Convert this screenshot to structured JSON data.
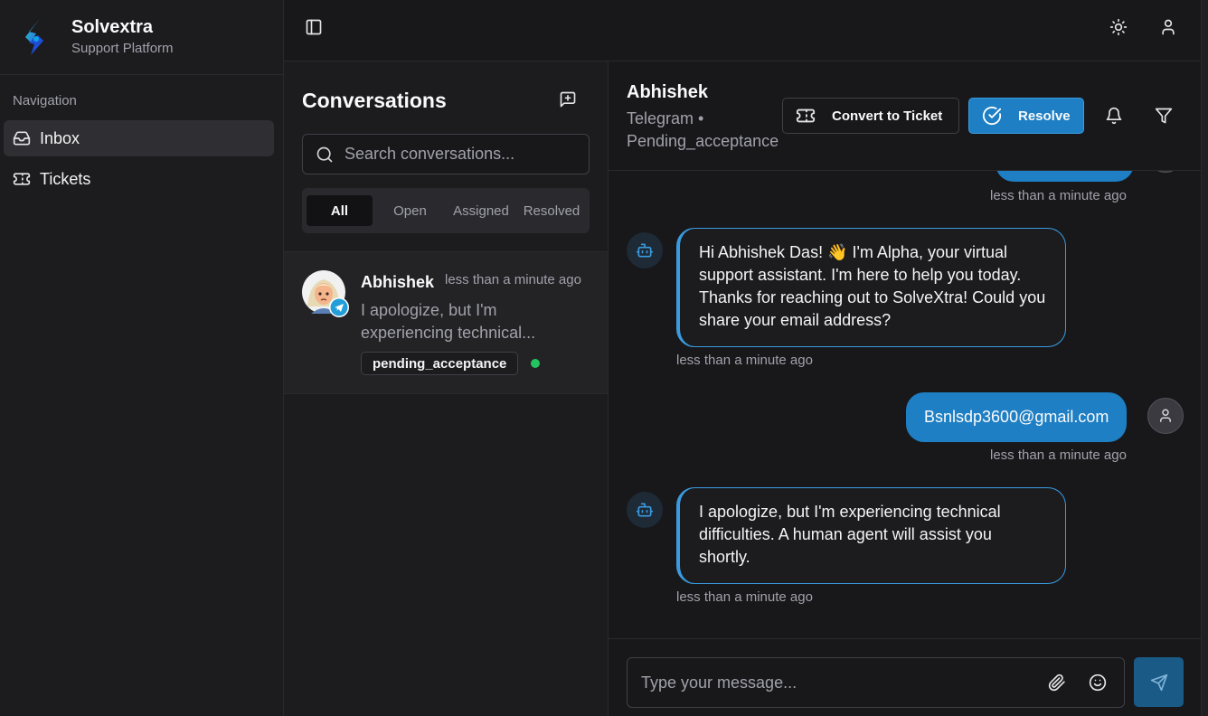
{
  "brand": {
    "name": "Solvextra",
    "subtitle": "Support Platform"
  },
  "nav": {
    "heading": "Navigation",
    "items": [
      {
        "label": "Inbox",
        "icon": "inbox-icon",
        "active": true
      },
      {
        "label": "Tickets",
        "icon": "ticket-icon",
        "active": false
      }
    ]
  },
  "topbar": {
    "icons": [
      "sidebar-toggle-icon",
      "sun-icon",
      "user-icon"
    ]
  },
  "conversations": {
    "title": "Conversations",
    "search_placeholder": "Search conversations...",
    "filters": [
      "All",
      "Open",
      "Assigned",
      "Resolved"
    ],
    "active_filter": "All",
    "items": [
      {
        "name": "Abhishek",
        "time": "less than a minute ago",
        "preview": "I apologize, but I'm experiencing technical...",
        "status": "pending_acceptance",
        "channel": "telegram-icon",
        "online": true
      }
    ]
  },
  "chat": {
    "name": "Abhishek",
    "channel": "Telegram •",
    "status": "Pending_acceptance",
    "convert_label": "Convert to Ticket",
    "resolve_label": "Resolve",
    "messages": [
      {
        "from": "user",
        "text": "",
        "time": "less than a minute ago"
      },
      {
        "from": "bot",
        "text": "Hi Abhishek Das! 👋 I'm Alpha, your virtual support assistant. I'm here to help you today. Thanks for reaching out to SolveXtra! Could you share your email address?",
        "time": "less than a minute ago"
      },
      {
        "from": "user",
        "text": "Bsnlsdp3600@gmail.com",
        "time": "less than a minute ago"
      },
      {
        "from": "bot",
        "text": "I apologize, but I'm experiencing technical difficulties. A human agent will assist you shortly.",
        "time": "less than a minute ago"
      }
    ],
    "composer_placeholder": "Type your message..."
  },
  "colors": {
    "accent": "#1e7fc4",
    "online": "#22c55e",
    "background": "#18181b"
  }
}
